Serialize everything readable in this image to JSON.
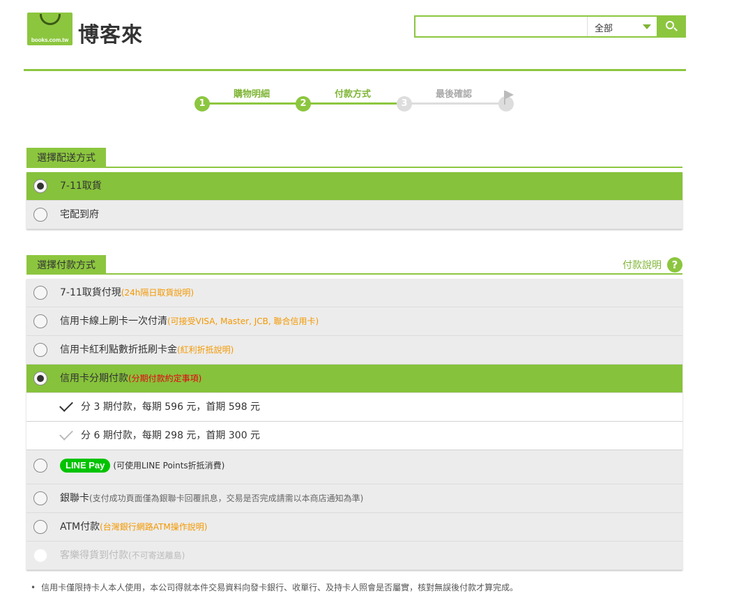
{
  "header": {
    "logo_text": "books.com.tw",
    "brand_name": "博客來",
    "search": {
      "value": "",
      "placeholder": "",
      "scope": "全部"
    }
  },
  "steps": [
    {
      "num": "1",
      "label": "購物明細",
      "state": "done"
    },
    {
      "num": "2",
      "label": "付款方式",
      "state": "done"
    },
    {
      "num": "3",
      "label": "最後確認",
      "state": "todo"
    }
  ],
  "shipping": {
    "title": "選擇配送方式",
    "options": [
      {
        "label": "7-11取貨",
        "selected": true
      },
      {
        "label": "宅配到府",
        "selected": false
      }
    ]
  },
  "payment": {
    "title": "選擇付款方式",
    "help_label": "付款說明",
    "help_icon": "?",
    "options": [
      {
        "label": "7-11取貨付現",
        "note": "(24h隔日取貨說明)"
      },
      {
        "label": "信用卡線上刷卡一次付清",
        "note": "(可接受VISA, Master, JCB, 聯合信用卡)"
      },
      {
        "label": "信用卡紅利點數折抵刷卡金",
        "note": "(紅利折抵說明)"
      },
      {
        "label": "信用卡分期付款",
        "note": "(分期付款約定事項)"
      }
    ],
    "installments": [
      {
        "label": "分 3 期付款，每期 596 元，首期 598 元",
        "checked": true
      },
      {
        "label": "分 6 期付款，每期 298 元，首期 300 元",
        "checked": false
      }
    ],
    "linepay": {
      "badge": "LINE Pay",
      "note": "(可使用LINE Points折抵消費)"
    },
    "unionpay": {
      "label": "銀聯卡",
      "note": "(支付成功頁面僅為銀聯卡回覆訊息，交易是否完成請需以本商店通知為準)"
    },
    "atm": {
      "label": "ATM付款",
      "note": "(台灣銀行網路ATM操作說明)"
    },
    "cod": {
      "label": "客樂得貨到付款",
      "note": "(不可寄送離島)"
    }
  },
  "footer": {
    "bullet": "•",
    "text": "信用卡僅限持卡人本人使用，本公司得就本件交易資料向發卡銀行、收單行、及持卡人照會是否屬實，核對無誤後付款才算完成。"
  },
  "colors": {
    "accent": "#8cc63f",
    "selected_row": "#86c23b",
    "note_orange": "#f39800",
    "note_red": "#e60012",
    "linepay_green": "#00c300"
  }
}
